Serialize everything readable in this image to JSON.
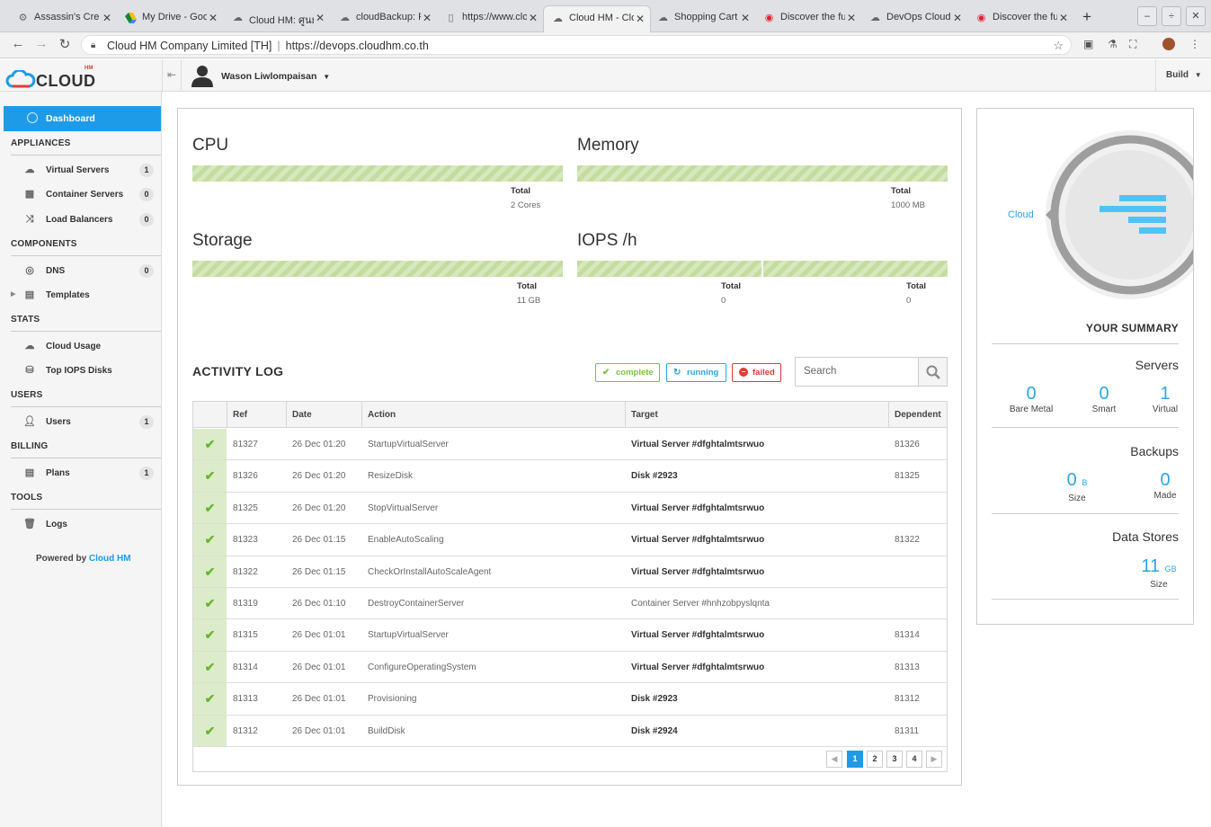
{
  "browser": {
    "tabs": [
      {
        "title": "Assassin's Cre",
        "icon": "gear-icon"
      },
      {
        "title": "My Drive - Goo",
        "icon": "drive-icon"
      },
      {
        "title": "Cloud HM: ศูนย์",
        "icon": "cloud-icon"
      },
      {
        "title": "cloudBackup: F",
        "icon": "cloud-icon"
      },
      {
        "title": "https://www.clo",
        "icon": "page-icon"
      },
      {
        "title": "Cloud HM - Clo",
        "icon": "cloud-icon",
        "active": true
      },
      {
        "title": "Shopping Cart",
        "icon": "cloud-icon"
      },
      {
        "title": "Discover the fu",
        "icon": "chrome-icon"
      },
      {
        "title": "DevOps Cloud",
        "icon": "cloud-icon"
      },
      {
        "title": "Discover the fu",
        "icon": "chrome-icon"
      }
    ],
    "org": "Cloud HM Company Limited [TH]",
    "url": "https://devops.cloudhm.co.th"
  },
  "header": {
    "logo_text": "CLOUD",
    "logo_badge": "HM",
    "user_name": "Wason Liwlompaisan",
    "build_label": "Build"
  },
  "sidebar": {
    "dashboard": "Dashboard",
    "sections": {
      "appliances": "APPLIANCES",
      "components": "COMPONENTS",
      "stats": "STATS",
      "users": "USERS",
      "billing": "BILLING",
      "tools": "TOOLS"
    },
    "items": {
      "virtual_servers": {
        "label": "Virtual Servers",
        "count": "1"
      },
      "container_servers": {
        "label": "Container Servers",
        "count": "0"
      },
      "load_balancers": {
        "label": "Load Balancers",
        "count": "0"
      },
      "dns": {
        "label": "DNS",
        "count": "0"
      },
      "templates": {
        "label": "Templates"
      },
      "cloud_usage": {
        "label": "Cloud Usage"
      },
      "top_iops": {
        "label": "Top IOPS Disks"
      },
      "users": {
        "label": "Users",
        "count": "1"
      },
      "plans": {
        "label": "Plans",
        "count": "1"
      },
      "logs": {
        "label": "Logs"
      }
    },
    "powered_prefix": "Powered by",
    "powered_brand": "Cloud HM"
  },
  "metrics": {
    "cpu": {
      "title": "CPU",
      "total_label": "Total",
      "total_value": "2 Cores"
    },
    "memory": {
      "title": "Memory",
      "total_label": "Total",
      "total_value": "1000 MB"
    },
    "storage": {
      "title": "Storage",
      "total_label": "Total",
      "total_value": "11 GB"
    },
    "iops": {
      "title": "IOPS /h",
      "total1_label": "Total",
      "total1_value": "0",
      "total2_label": "Total",
      "total2_value": "0"
    }
  },
  "activity": {
    "title": "ACTIVITY LOG",
    "filters": {
      "complete": "complete",
      "running": "running",
      "failed": "failed"
    },
    "search_placeholder": "Search",
    "columns": {
      "ref": "Ref",
      "date": "Date",
      "action": "Action",
      "target": "Target",
      "dependent": "Dependent"
    },
    "rows": [
      {
        "ref": "81327",
        "date": "26 Dec 01:20",
        "action": "StartupVirtualServer",
        "target": "Virtual Server #dfghtalmtsrwuo",
        "dependent": "81326"
      },
      {
        "ref": "81326",
        "date": "26 Dec 01:20",
        "action": "ResizeDisk",
        "target": "Disk #2923",
        "dependent": "81325"
      },
      {
        "ref": "81325",
        "date": "26 Dec 01:20",
        "action": "StopVirtualServer",
        "target": "Virtual Server #dfghtalmtsrwuo",
        "dependent": ""
      },
      {
        "ref": "81323",
        "date": "26 Dec 01:15",
        "action": "EnableAutoScaling",
        "target": "Virtual Server #dfghtalmtsrwuo",
        "dependent": "81322"
      },
      {
        "ref": "81322",
        "date": "26 Dec 01:15",
        "action": "CheckOrInstallAutoScaleAgent",
        "target": "Virtual Server #dfghtalmtsrwuo",
        "dependent": ""
      },
      {
        "ref": "81319",
        "date": "26 Dec 01:10",
        "action": "DestroyContainerServer",
        "target": "Container Server #hnhzobpyslqnta",
        "dependent": ""
      },
      {
        "ref": "81315",
        "date": "26 Dec 01:01",
        "action": "StartupVirtualServer",
        "target": "Virtual Server #dfghtalmtsrwuo",
        "dependent": "81314"
      },
      {
        "ref": "81314",
        "date": "26 Dec 01:01",
        "action": "ConfigureOperatingSystem",
        "target": "Virtual Server #dfghtalmtsrwuo",
        "dependent": "81313"
      },
      {
        "ref": "81313",
        "date": "26 Dec 01:01",
        "action": "Provisioning",
        "target": "Disk #2923",
        "dependent": "81312"
      },
      {
        "ref": "81312",
        "date": "26 Dec 01:01",
        "action": "BuildDisk",
        "target": "Disk #2924",
        "dependent": "81311"
      }
    ],
    "pages": [
      "1",
      "2",
      "3",
      "4"
    ],
    "current_page": "1"
  },
  "summary": {
    "cloud_label": "Cloud",
    "title": "YOUR SUMMARY",
    "servers": {
      "title": "Servers",
      "bare_metal": {
        "value": "0",
        "label": "Bare Metal"
      },
      "smart": {
        "value": "0",
        "label": "Smart"
      },
      "virtual": {
        "value": "1",
        "label": "Virtual"
      }
    },
    "backups": {
      "title": "Backups",
      "size": {
        "value": "0",
        "unit": "B",
        "label": "Size"
      },
      "made": {
        "value": "0",
        "label": "Made"
      }
    },
    "data_stores": {
      "title": "Data Stores",
      "size": {
        "value": "11",
        "unit": "GB",
        "label": "Size"
      }
    }
  },
  "colors": {
    "accent": "#1e9be8",
    "success": "#7ac142",
    "danger": "#e53935",
    "bar": "#c4dc9f"
  }
}
